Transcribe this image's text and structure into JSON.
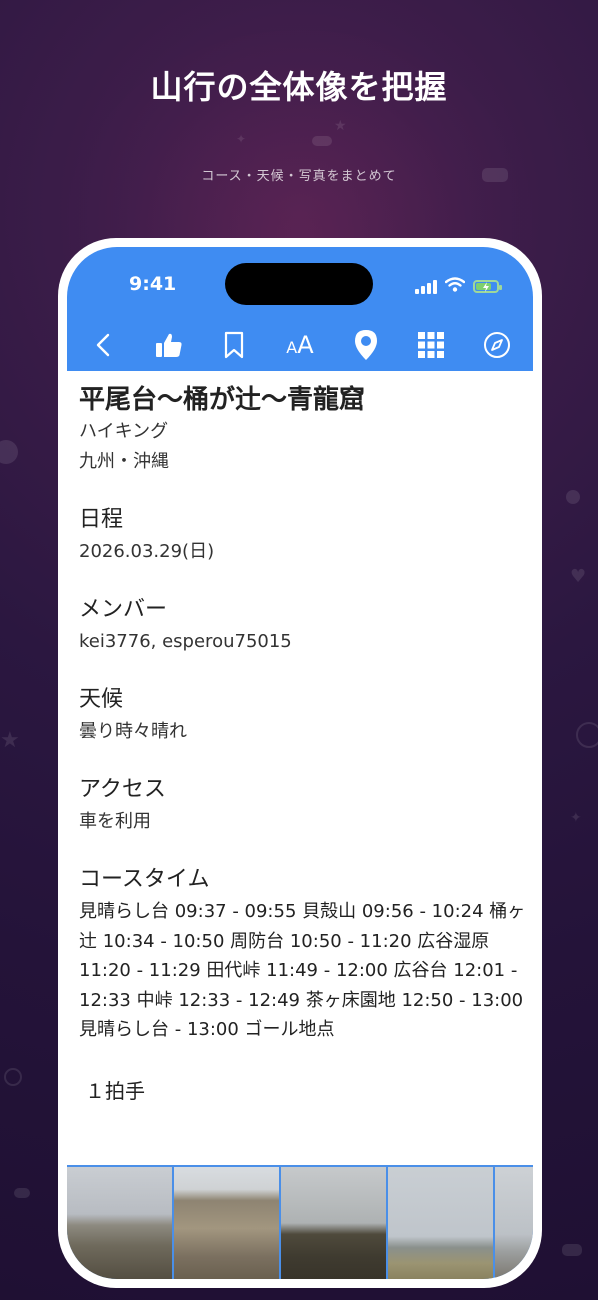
{
  "promo": {
    "headline": "山行の全体像を把握",
    "subline": "コース・天候・写真をまとめて"
  },
  "statusbar": {
    "time": "9:41"
  },
  "toolbar": {
    "icons": [
      "back-icon",
      "thumbs-up-icon",
      "bookmark-icon",
      "font-size-icon",
      "map-pin-icon",
      "grid-icon",
      "compass-icon"
    ],
    "font_size_label": "AA"
  },
  "record": {
    "title": "平尾台〜桶が辻〜青龍窟",
    "activity": "ハイキング",
    "region": "九州・沖縄",
    "sections": [
      {
        "heading": "日程",
        "value": "2026.03.29(日)"
      },
      {
        "heading": "メンバー",
        "value": "kei3776, esperou75015"
      },
      {
        "heading": "天候",
        "value": "曇り時々晴れ"
      },
      {
        "heading": "アクセス",
        "value": "車を利用"
      }
    ],
    "course_heading": "コースタイム",
    "course_text": "見晴らし台 09:37 - 09:55 貝殻山 09:56 - 10:24 桶ヶ辻 10:34 - 10:50 周防台 10:50 - 11:20 広谷湿原 11:20 - 11:29 田代峠 11:49 - 12:00 広谷台 12:01 - 12:33 中峠 12:33 - 12:49 茶ヶ床園地 12:50 - 13:00 見晴らし台 - 13:00 ゴール地点",
    "likes": "１拍手"
  },
  "colors": {
    "accent": "#3f8cf2",
    "background": "#241339"
  }
}
